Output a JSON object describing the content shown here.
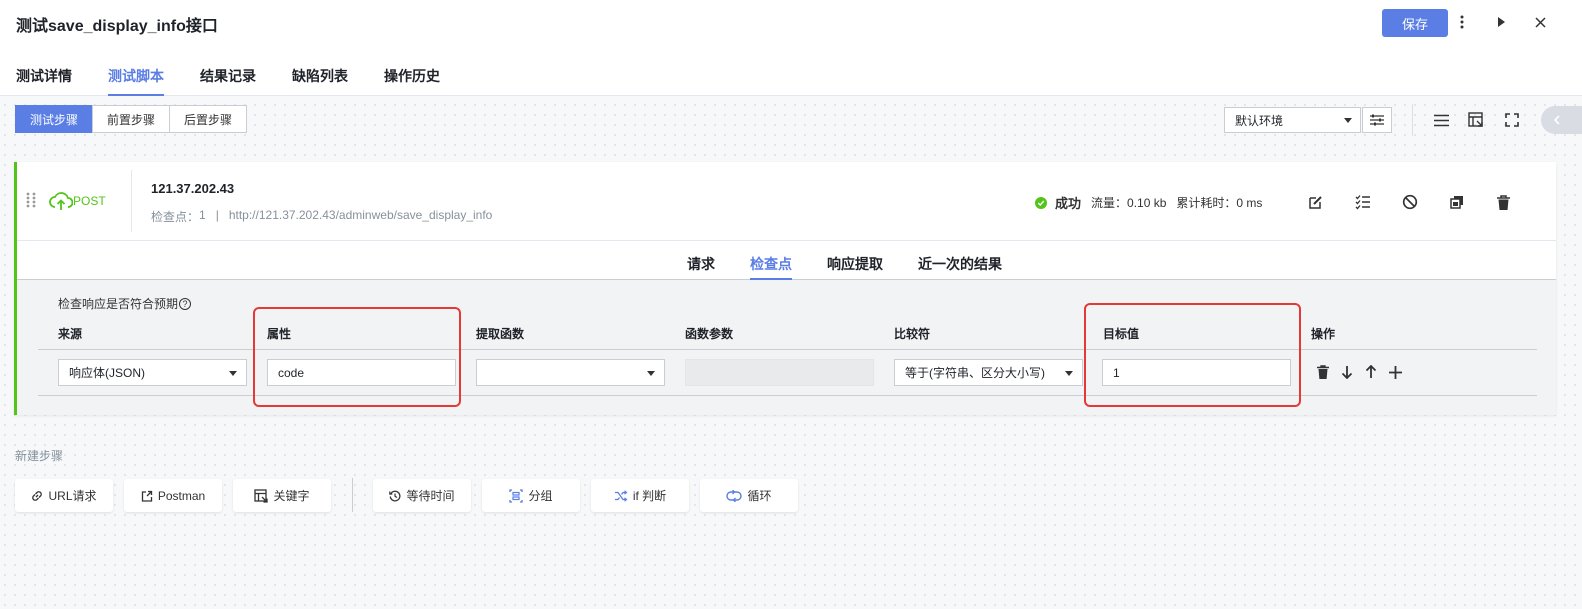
{
  "header": {
    "title": "测试save_display_info接口",
    "save_label": "保存",
    "tabs": [
      "测试详情",
      "测试脚本",
      "结果记录",
      "缺陷列表",
      "操作历史"
    ]
  },
  "toolbar": {
    "segments": [
      "测试步骤",
      "前置步骤",
      "后置步骤"
    ],
    "environment": "默认环境"
  },
  "step": {
    "method": "POST",
    "host": "121.37.202.43",
    "checkpoints_label": "检查点：",
    "checkpoints_count": "1",
    "separator": "|",
    "url": "http://121.37.202.43/adminweb/save_display_info",
    "status": "成功",
    "traffic": "流量：0.10 kb",
    "elapsed": "累计耗时：0 ms"
  },
  "detail_tabs": [
    "请求",
    "检查点",
    "响应提取",
    "近一次的结果"
  ],
  "checkpoint": {
    "note": "检查响应是否符合预期",
    "help": "?",
    "columns": [
      "来源",
      "属性",
      "提取函数",
      "函数参数",
      "比较符",
      "目标值",
      "操作"
    ],
    "row": {
      "source": "响应体(JSON)",
      "attribute": "code",
      "extract_function": "",
      "function_param": "",
      "comparator": "等于(字符串、区分大小写)",
      "target": "1"
    }
  },
  "new_step": {
    "label": "新建步骤",
    "buttons": [
      "URL请求",
      "Postman",
      "关键字",
      "等待时间",
      "分组",
      "if 判断",
      "循环"
    ]
  },
  "colors": {
    "accent": "#5b7ee5",
    "success": "#52c41a",
    "highlight": "#e53935"
  }
}
